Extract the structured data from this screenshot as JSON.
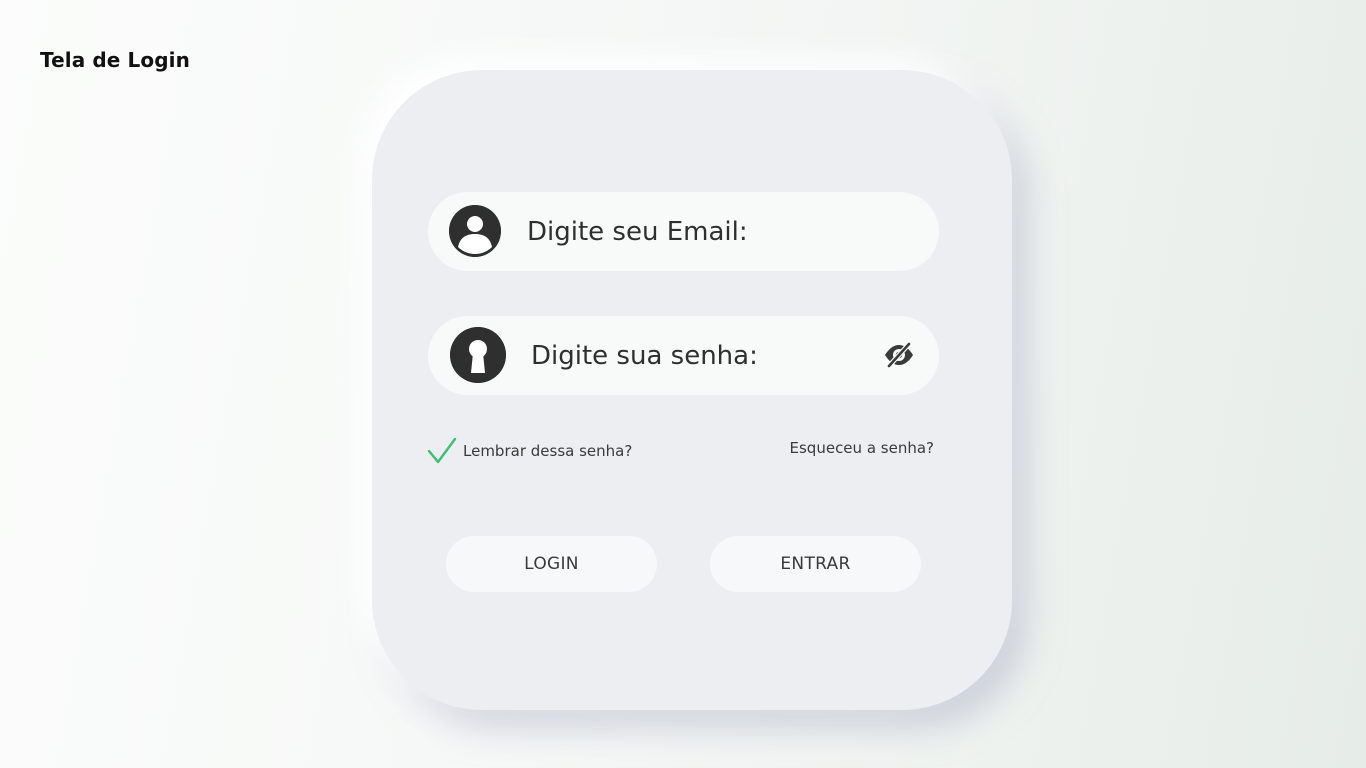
{
  "page": {
    "title": "Tela de Login"
  },
  "form": {
    "email": {
      "placeholder": "Digite seu Email:",
      "value": "",
      "icon": "user-icon"
    },
    "password": {
      "placeholder": "Digite sua senha:",
      "value": "",
      "icon": "keyhole-icon",
      "toggle_icon": "eye-slash-icon"
    },
    "remember": {
      "label": "Lembrar dessa senha?",
      "checked": true,
      "icon": "checkmark-icon"
    },
    "forgot_label": "Esqueceu a senha?",
    "buttons": {
      "login_label": "LOGIN",
      "enter_label": "ENTRAR"
    }
  },
  "colors": {
    "card": "#eceef1",
    "field": "#f8f9f9",
    "icon": "#2f2f2f",
    "check": "#3dbf72",
    "button": "#f7f8fa"
  }
}
